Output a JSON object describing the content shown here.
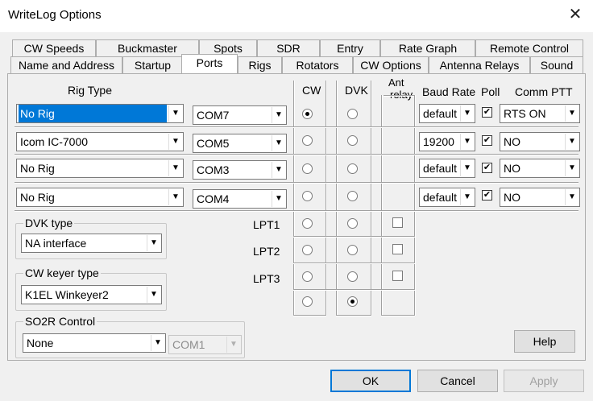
{
  "window": {
    "title": "WriteLog Options",
    "close_icon": "close-icon"
  },
  "tabs_row1": [
    "CW Speeds",
    "Buckmaster",
    "Spots",
    "SDR",
    "Entry",
    "Rate Graph",
    "Remote Control"
  ],
  "tabs_row2": [
    "Name and Address",
    "Startup",
    "Ports",
    "Rigs",
    "Rotators",
    "CW Options",
    "Antenna Relays",
    "Sound"
  ],
  "active_tab": "Ports",
  "headers": {
    "rig_type": "Rig Type",
    "cw": "CW",
    "dvk": "DVK",
    "ant_relay_1": "Ant",
    "ant_relay_2": "relay",
    "baud_rate": "Baud Rate",
    "poll": "Poll",
    "comm_ptt": "Comm PTT"
  },
  "rigs": [
    {
      "rig": "No Rig",
      "port": "COM7",
      "cw": true,
      "dvk": false,
      "baud": "default",
      "poll": true,
      "ptt": "RTS ON"
    },
    {
      "rig": "Icom IC-7000",
      "port": "COM5",
      "cw": false,
      "dvk": false,
      "baud": "19200",
      "poll": true,
      "ptt": "NO"
    },
    {
      "rig": "No Rig",
      "port": "COM3",
      "cw": false,
      "dvk": false,
      "baud": "default",
      "poll": true,
      "ptt": "NO"
    },
    {
      "rig": "No Rig",
      "port": "COM4",
      "cw": false,
      "dvk": false,
      "baud": "default",
      "poll": true,
      "ptt": "NO"
    }
  ],
  "lpt": [
    {
      "label": "LPT1",
      "cw": false,
      "dvk": false,
      "relay": false
    },
    {
      "label": "LPT2",
      "cw": false,
      "dvk": false,
      "relay": false
    },
    {
      "label": "LPT3",
      "cw": false,
      "dvk": false,
      "relay": false
    }
  ],
  "extra_row": {
    "cw": false,
    "dvk": true
  },
  "dvk_type": {
    "label": "DVK type",
    "value": "NA interface"
  },
  "cw_keyer": {
    "label": "CW keyer type",
    "value": "K1EL Winkeyer2"
  },
  "so2r": {
    "label": "SO2R Control",
    "value": "None",
    "port": "COM1"
  },
  "buttons": {
    "help": "Help",
    "ok": "OK",
    "cancel": "Cancel",
    "apply": "Apply"
  }
}
